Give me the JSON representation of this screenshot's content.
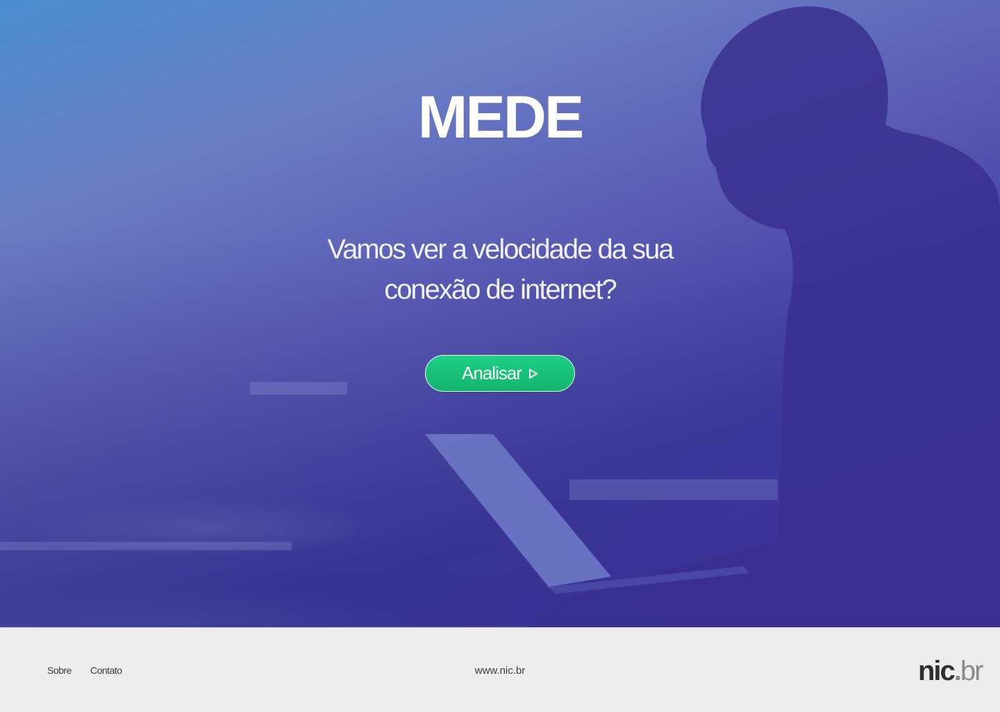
{
  "hero": {
    "title": "MEDE",
    "subtitle_line1": "Vamos ver a velocidade da sua",
    "subtitle_line2": "conexão de internet?",
    "cta_label": "Analisar",
    "cta_icon": "play-outline-icon",
    "colors": {
      "gradient_start": "#4a8dd0",
      "gradient_end": "#4a32a8",
      "cta_green": "#17c27a"
    }
  },
  "footer": {
    "links": [
      "Sobre",
      "Contato"
    ],
    "url": "www.nic.br",
    "logo": {
      "prefix": "nic",
      "dot": ".",
      "suffix": "br"
    }
  }
}
